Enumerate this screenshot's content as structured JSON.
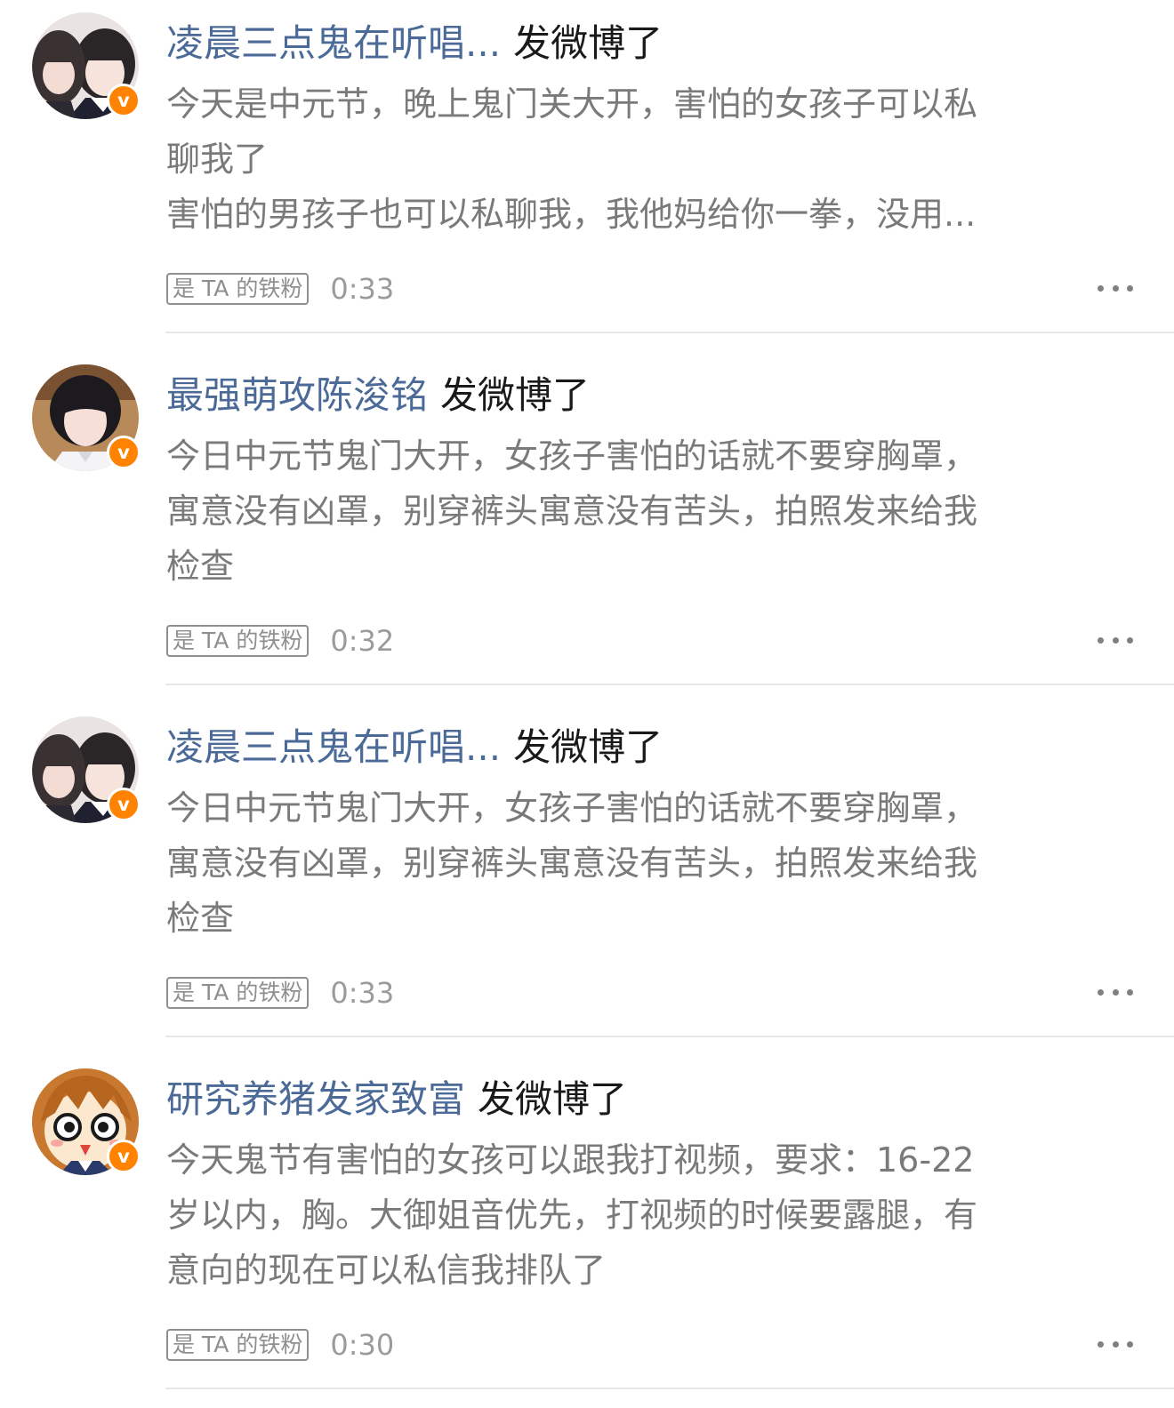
{
  "feed": {
    "items": [
      {
        "avatar_icon": "girls-selfie-avatar",
        "verified_badge": "v",
        "username": "凌晨三点鬼在听唱...",
        "action": "发微博了",
        "lines": [
          "今天是中元节，晚上鬼门关大开，害怕的女孩子可以私",
          "聊我了",
          "害怕的男孩子也可以私聊我，我他妈给你一拳，没用..."
        ],
        "fan_tag": "是 TA 的铁粉",
        "time": "0:33"
      },
      {
        "avatar_icon": "boy-portrait-avatar",
        "verified_badge": "v",
        "username": "最强萌攻陈浚铭",
        "action": "发微博了",
        "lines": [
          "今日中元节鬼门大开，女孩子害怕的话就不要穿胸罩，",
          "寓意没有凶罩，别穿裤头寓意没有苦头，拍照发来给我",
          "检查"
        ],
        "fan_tag": "是 TA 的铁粉",
        "time": "0:32"
      },
      {
        "avatar_icon": "girls-selfie-avatar",
        "verified_badge": "v",
        "username": "凌晨三点鬼在听唱...",
        "action": "发微博了",
        "lines": [
          "今日中元节鬼门大开，女孩子害怕的话就不要穿胸罩，",
          "寓意没有凶罩，别穿裤头寓意没有苦头，拍照发来给我",
          "检查"
        ],
        "fan_tag": "是 TA 的铁粉",
        "time": "0:33"
      },
      {
        "avatar_icon": "anime-girl-avatar",
        "verified_badge": "v",
        "username": "研究养猪发家致富",
        "action": "发微博了",
        "lines": [
          "今天鬼节有害怕的女孩可以跟我打视频，要求：16-22",
          "岁以内，胸。大御姐音优先，打视频的时候要露腿，有",
          "意向的现在可以私信我排队了"
        ],
        "fan_tag": "是 TA 的铁粉",
        "time": "0:30"
      }
    ]
  },
  "colors": {
    "username": "#4b6a98",
    "action": "#1a1a1a",
    "content": "#7a7a7a",
    "meta": "#9b9b9b",
    "badge": "#ff8200",
    "divider": "#e8e8e8"
  }
}
